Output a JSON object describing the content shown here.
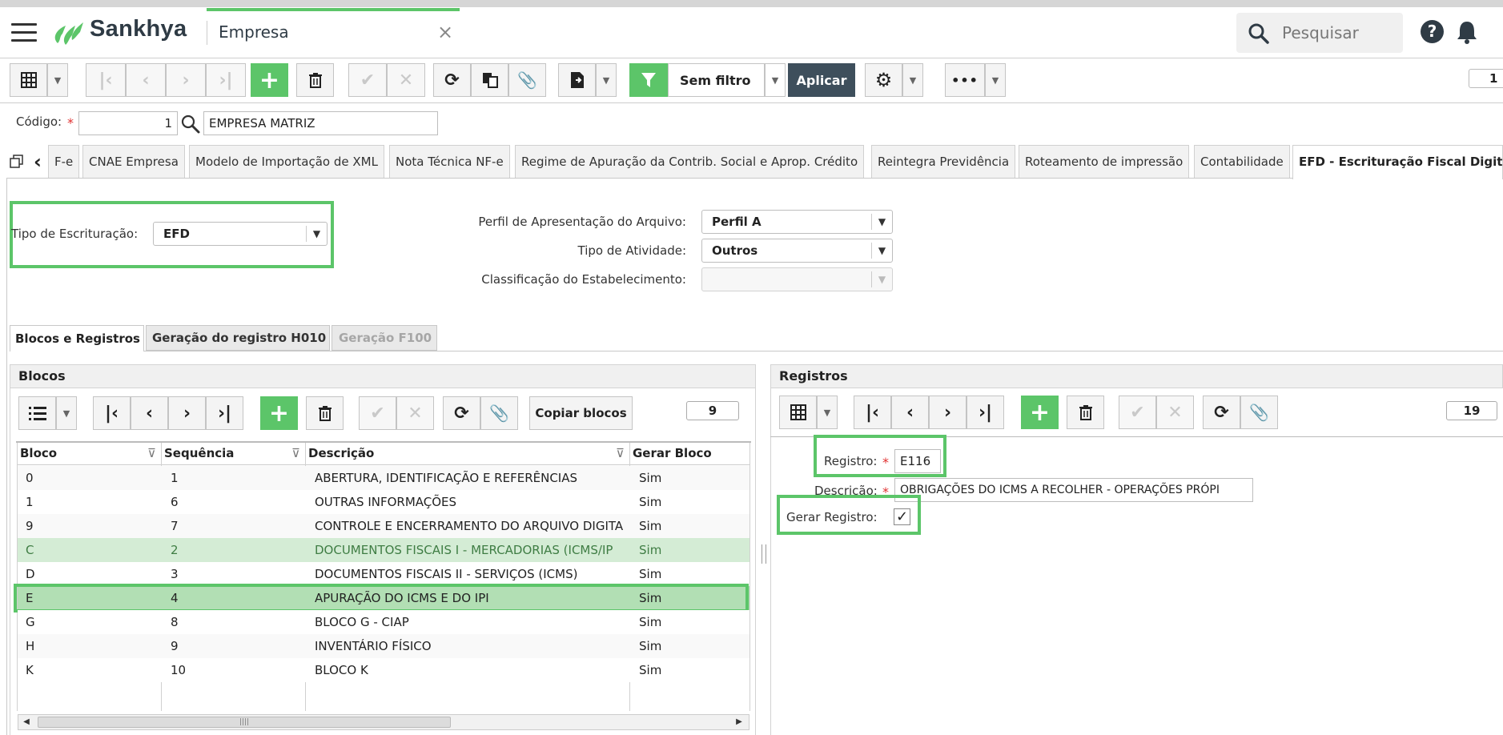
{
  "app": {
    "brand": "Sankhya",
    "tab_title": "Empresa",
    "search_placeholder": "Pesquisar"
  },
  "toolbar": {
    "filter_label": "Sem filtro",
    "apply_label": "Aplicar",
    "page_number": "1"
  },
  "header_form": {
    "codigo_label": "Código:",
    "codigo_value": "1",
    "empresa_name": "EMPRESA MATRIZ"
  },
  "tabs": [
    {
      "label": "F-e"
    },
    {
      "label": "CNAE Empresa"
    },
    {
      "label": "Modelo de Importação de XML"
    },
    {
      "label": "Nota Técnica NF-e"
    },
    {
      "label": "Regime de Apuração da Contrib. Social e Aprop. Crédito"
    },
    {
      "label": "Reintegra Previdência"
    },
    {
      "label": "Roteamento de impressão"
    },
    {
      "label": "Contabilidade"
    },
    {
      "label": "EFD - Escrituração Fiscal Digital"
    }
  ],
  "efd_form": {
    "tipo_label": "Tipo de Escrituração:",
    "tipo_value": "EFD",
    "perfil_label": "Perfil de Apresentação do Arquivo:",
    "perfil_value": "Perfil A",
    "atividade_label": "Tipo de Atividade:",
    "atividade_value": "Outros",
    "classificacao_label": "Classificação do Estabelecimento:",
    "classificacao_value": ""
  },
  "subtabs": [
    {
      "label": "Blocos e Registros"
    },
    {
      "label": "Geração do registro H010"
    },
    {
      "label": "Geração F100"
    }
  ],
  "blocos": {
    "title": "Blocos",
    "copy_button": "Copiar blocos",
    "count": "9",
    "columns": [
      "Bloco",
      "Sequência",
      "Descrição",
      "Gerar Bloco"
    ],
    "rows": [
      {
        "bloco": "0",
        "seq": "1",
        "desc": "ABERTURA, IDENTIFICAÇÃO E REFERÊNCIAS",
        "gerar": "Sim"
      },
      {
        "bloco": "1",
        "seq": "6",
        "desc": "OUTRAS INFORMAÇÕES",
        "gerar": "Sim"
      },
      {
        "bloco": "9",
        "seq": "7",
        "desc": "CONTROLE E ENCERRAMENTO DO ARQUIVO DIGITA",
        "gerar": "Sim"
      },
      {
        "bloco": "C",
        "seq": "2",
        "desc": "DOCUMENTOS FISCAIS I - MERCADORIAS (ICMS/IP",
        "gerar": "Sim"
      },
      {
        "bloco": "D",
        "seq": "3",
        "desc": "DOCUMENTOS FISCAIS II - SERVIÇOS (ICMS)",
        "gerar": "Sim"
      },
      {
        "bloco": "E",
        "seq": "4",
        "desc": "APURAÇÃO DO ICMS E DO IPI",
        "gerar": "Sim"
      },
      {
        "bloco": "G",
        "seq": "8",
        "desc": "BLOCO G - CIAP",
        "gerar": "Sim"
      },
      {
        "bloco": "H",
        "seq": "9",
        "desc": "INVENTÁRIO FÍSICO",
        "gerar": "Sim"
      },
      {
        "bloco": "K",
        "seq": "10",
        "desc": "BLOCO K",
        "gerar": "Sim"
      }
    ]
  },
  "registros": {
    "title": "Registros",
    "count": "19",
    "registro_label": "Registro:",
    "registro_value": "E116",
    "descricao_label": "Descrição:",
    "descricao_value": "OBRIGAÇÕES DO ICMS A RECOLHER - OPERAÇÕES PRÓPI",
    "gerar_label": "Gerar Registro:"
  },
  "colors": {
    "accent": "#5cc569",
    "dark": "#2f3b45",
    "row_hover": "#d4ecd5",
    "row_selected": "#b2dfb4"
  }
}
